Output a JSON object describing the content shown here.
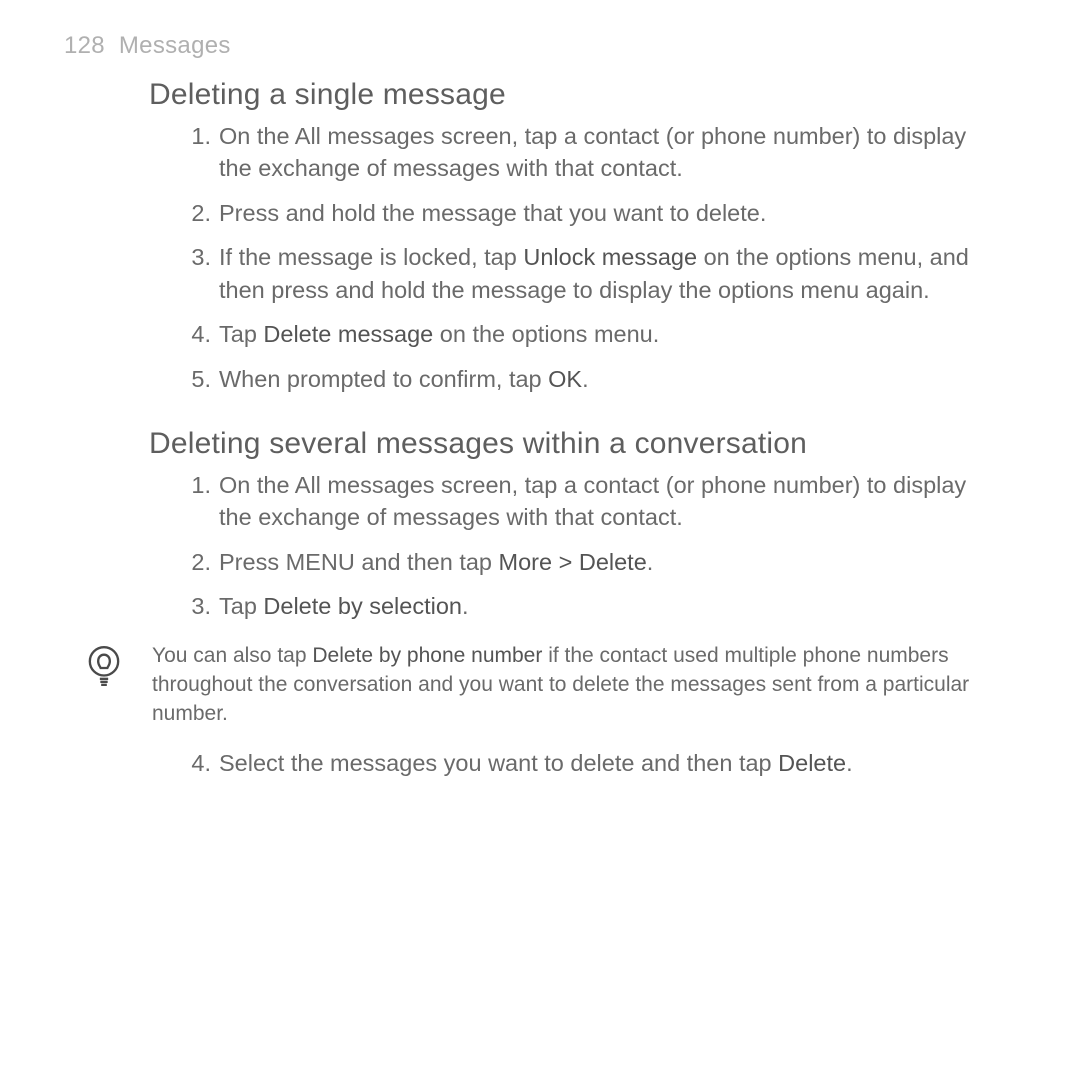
{
  "header": {
    "page_number": "128",
    "chapter": "Messages"
  },
  "section1": {
    "title": "Deleting a single message",
    "steps": {
      "s1": "On the All messages screen, tap a contact (or phone number) to display the exchange of messages with that contact.",
      "s2": "Press and hold the message that you want to delete.",
      "s3_a": "If the message is locked, tap ",
      "s3_b": "Unlock message",
      "s3_c": " on the options menu, and then press and hold the message to display the options menu again.",
      "s4_a": "Tap ",
      "s4_b": "Delete message",
      "s4_c": " on the options menu.",
      "s5_a": "When prompted to confirm, tap ",
      "s5_b": "OK",
      "s5_c": "."
    }
  },
  "section2": {
    "title": "Deleting several messages within a conversation",
    "steps": {
      "s1": "On the All messages screen, tap a contact (or phone number) to display the exchange of messages with that contact.",
      "s2_a": "Press MENU and then tap ",
      "s2_b": "More > Delete",
      "s2_c": ".",
      "s3_a": "Tap ",
      "s3_b": "Delete by selection",
      "s3_c": ".",
      "s4_a": "Select the messages you want to delete and then tap ",
      "s4_b": "Delete",
      "s4_c": "."
    },
    "tip": {
      "a": "You can also tap ",
      "b": "Delete by phone number",
      "c": " if the contact used multiple phone numbers throughout the conversation and you want to delete the messages sent from a particular number."
    }
  },
  "numbers": {
    "n1": "1.",
    "n2": "2.",
    "n3": "3.",
    "n4": "4.",
    "n5": "5."
  }
}
